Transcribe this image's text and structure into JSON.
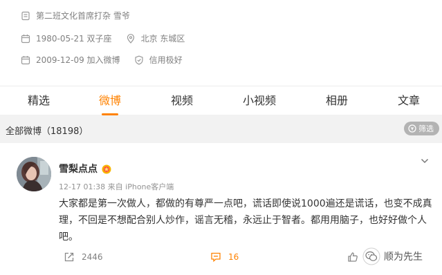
{
  "profile": {
    "tag_line": "第二班文化首席打杂 雪爷",
    "birthday": "1980-05-21 双子座",
    "location": "北京 东城区",
    "joined": "2009-12-09 加入微博",
    "credit": "信用极好"
  },
  "tabs": [
    {
      "label": "精选"
    },
    {
      "label": "微博",
      "active": true
    },
    {
      "label": "视频"
    },
    {
      "label": "小视频"
    },
    {
      "label": "相册"
    },
    {
      "label": "文章"
    }
  ],
  "feed": {
    "count_label": "全部微博（18198）",
    "filter_label": "筛选"
  },
  "post": {
    "username": "雪梨点点",
    "time": "12-17 01:38",
    "source": "来自 iPhone客户端",
    "text": "大家都是第一次做人，都做的有尊严一点吧，谎话即使说1000遍还是谎话，也变不成真理，不回是不想配合别人炒作，谣言无稽，永远止于智者。都用用脑子，也好好做个人吧。",
    "repost_count": "2446",
    "comment_count": "16",
    "like_count_partial": "5"
  },
  "watermark": {
    "text": "顺为先生"
  },
  "colors": {
    "accent": "#ff8200",
    "muted": "#808080",
    "page_bg": "#f2f2f2"
  },
  "icons": {
    "tag": "tag-icon",
    "calendar": "calendar-icon",
    "location": "location-pin-icon",
    "joined": "calendar-icon",
    "credit": "shield-icon",
    "filter": "filter-icon",
    "badge": "gold-badge-icon",
    "more": "chevron-down-icon",
    "repost": "repost-icon",
    "comment": "comment-icon",
    "like": "thumbs-up-icon",
    "watermark": "wechat-logo-icon"
  }
}
